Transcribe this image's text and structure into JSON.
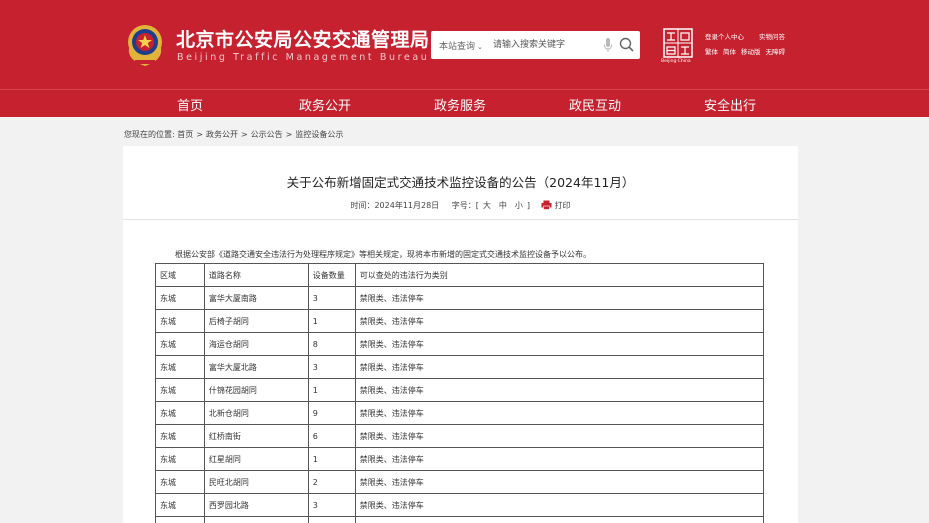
{
  "header": {
    "title": "北京市公安局公安交通管理局",
    "subtitle": "Beijing Traffic Management Bureau",
    "search": {
      "scope_label": "本站查询",
      "placeholder": "请输入搜索关键字"
    },
    "capital_logo_text": "Beijing·China",
    "utility_row1": [
      "登录个人中心",
      "实物问答"
    ],
    "utility_row2": [
      "繁体",
      "简体",
      "移动版",
      "无障碍"
    ]
  },
  "nav": {
    "items": [
      "首页",
      "政务公开",
      "政务服务",
      "政民互动",
      "安全出行"
    ]
  },
  "breadcrumb": {
    "prefix": "您现在的位置:",
    "items": [
      "首页",
      "政务公开",
      "公示公告",
      "监控设备公示"
    ]
  },
  "article": {
    "title": "关于公布新增固定式交通技术监控设备的公告（2024年11月）",
    "time_label": "时间：",
    "time_value": "2024年11月28日",
    "font_label": "字号：",
    "font_sizes": [
      "大",
      "中",
      "小"
    ],
    "print_label": "打印",
    "intro": "根据公安部《道路交通安全违法行为处理程序规定》等相关规定，现将本市新增的固定式交通技术监控设备予以公布。",
    "table": {
      "headers": [
        "区域",
        "道路名称",
        "设备数量",
        "可以查处的违法行为类别"
      ],
      "rows": [
        [
          "东城",
          "富华大厦南路",
          "3",
          "禁限类、违法停车"
        ],
        [
          "东城",
          "后椅子胡同",
          "1",
          "禁限类、违法停车"
        ],
        [
          "东城",
          "海运仓胡同",
          "8",
          "禁限类、违法停车"
        ],
        [
          "东城",
          "富华大厦北路",
          "3",
          "禁限类、违法停车"
        ],
        [
          "东城",
          "什锦花园胡同",
          "1",
          "禁限类、违法停车"
        ],
        [
          "东城",
          "北新仓胡同",
          "9",
          "禁限类、违法停车"
        ],
        [
          "东城",
          "红桥南街",
          "6",
          "禁限类、违法停车"
        ],
        [
          "东城",
          "红星胡同",
          "1",
          "禁限类、违法停车"
        ],
        [
          "东城",
          "民旺北胡同",
          "2",
          "禁限类、违法停车"
        ],
        [
          "东城",
          "西罗园北路",
          "3",
          "禁限类、违法停车"
        ],
        [
          "",
          "",
          "",
          ""
        ]
      ]
    }
  },
  "colors": {
    "brand_red": "#c5212f",
    "page_bg": "#f2f2f2"
  },
  "icons": [
    "police-emblem-icon",
    "chevron-down-icon",
    "microphone-icon",
    "search-icon",
    "capital-logo-icon",
    "print-icon"
  ]
}
